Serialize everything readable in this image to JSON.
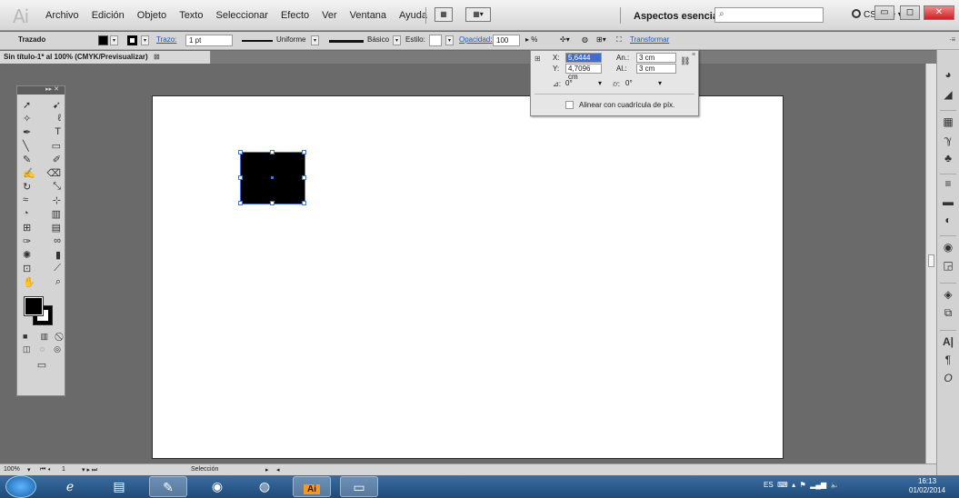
{
  "menubar": {
    "logo": "Ai",
    "menus": [
      "Archivo",
      "Edición",
      "Objeto",
      "Texto",
      "Seleccionar",
      "Efecto",
      "Ver",
      "Ventana",
      "Ayuda"
    ],
    "workspace": "Aspectos esenciales ▾",
    "cslive": "CS Live ▾"
  },
  "controlbar": {
    "selection_type": "Trazado",
    "stroke_label": "Trazo:",
    "stroke_weight": "1 pt",
    "profile": "Uniforme",
    "brush": "Básico",
    "style_label": "Estilo:",
    "opacity_label": "Opacidad:",
    "opacity_value": "100",
    "opacity_unit": "%",
    "transform_link": "Transformar"
  },
  "document": {
    "tab_title": "Sin título-1* al 100% (CMYK/Previsualizar)",
    "tab_close": "⊠"
  },
  "transform": {
    "x_label": "X:",
    "x_value": "5,6444 cm",
    "y_label": "Y:",
    "y_value": "4,7096 cm",
    "w_label": "An.:",
    "w_value": "3 cm",
    "h_label": "Al.:",
    "h_value": "3 cm",
    "angle_value": "0°",
    "shear_value": "0°",
    "align_pixel_label": "Alinear con cuadrícula de píx."
  },
  "statusbar": {
    "zoom": "100%",
    "page": "1",
    "tool": "Selección"
  },
  "taskbar": {
    "lang": "ES",
    "time": "16:13",
    "date": "01/02/2014"
  },
  "colors": {
    "selection": "#4a6fd6",
    "taskbar": "#2b5b8f",
    "illustrator_app": "#f29a1a"
  }
}
